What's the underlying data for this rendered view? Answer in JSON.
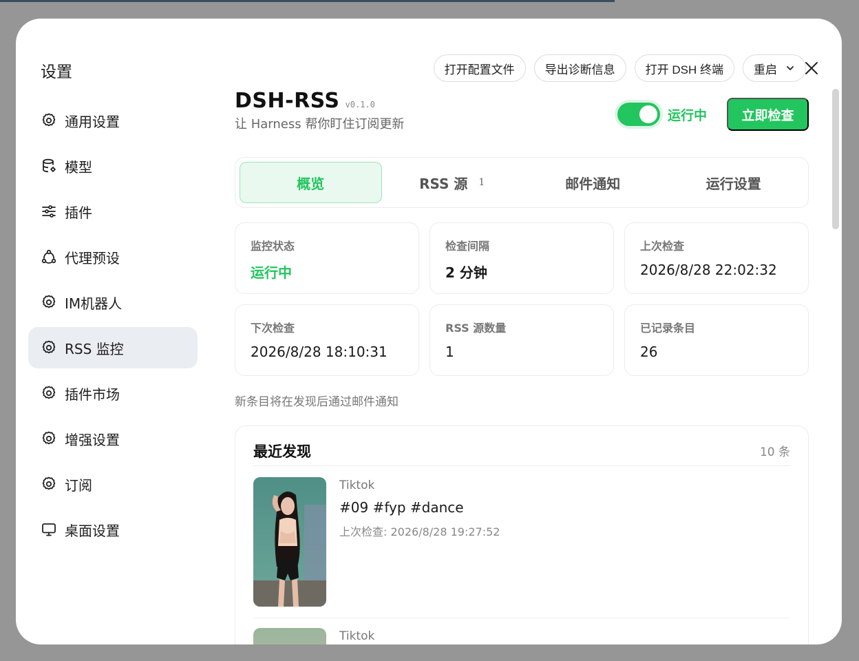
{
  "sidebar": {
    "title": "设置",
    "items": [
      {
        "label": "通用设置",
        "icon": "gear-icon"
      },
      {
        "label": "模型",
        "icon": "database-icon"
      },
      {
        "label": "插件",
        "icon": "sliders-icon"
      },
      {
        "label": "代理预设",
        "icon": "share-icon"
      },
      {
        "label": "IM机器人",
        "icon": "gear-icon"
      },
      {
        "label": "RSS 监控",
        "icon": "gear-icon",
        "active": true
      },
      {
        "label": "插件市场",
        "icon": "gear-icon"
      },
      {
        "label": "增强设置",
        "icon": "gear-icon"
      },
      {
        "label": "订阅",
        "icon": "gear-icon"
      },
      {
        "label": "桌面设置",
        "icon": "monitor-icon"
      }
    ]
  },
  "toolbar": {
    "open_config": "打开配置文件",
    "export_diag": "导出诊断信息",
    "open_terminal": "打开 DSH 终端",
    "restart": "重启"
  },
  "plugin": {
    "name": "DSH-RSS",
    "version": "v0.1.0",
    "subtitle": "让 Harness 帮你盯住订阅更新",
    "status_label": "运行中",
    "enabled": true,
    "check_now": "立即检查"
  },
  "tabs": [
    {
      "label": "概览",
      "active": true
    },
    {
      "label": "RSS 源",
      "badge": "1"
    },
    {
      "label": "邮件通知"
    },
    {
      "label": "运行设置"
    }
  ],
  "stats": [
    {
      "label": "监控状态",
      "value": "运行中",
      "style": "green"
    },
    {
      "label": "检查间隔",
      "value": "2 分钟",
      "style": "bold"
    },
    {
      "label": "上次检查",
      "value": "2026/8/28 22:02:32"
    },
    {
      "label": "下次检查",
      "value": "2026/8/28 18:10:31"
    },
    {
      "label": "RSS 源数量",
      "value": "1"
    },
    {
      "label": "已记录条目",
      "value": "26"
    }
  ],
  "hint": "新条目将在发现后通过邮件通知",
  "recent": {
    "title": "最近发现",
    "count": "10 条",
    "items": [
      {
        "source": "Tiktok",
        "title": "#09 #fyp #dance",
        "meta": "上次检查: 2026/8/28 19:27:52"
      },
      {
        "source": "Tiktok"
      }
    ]
  },
  "colors": {
    "accent": "#22c55e",
    "active_nav_bg": "#eaedf1",
    "tab_active_bg": "#e9f9ef"
  }
}
